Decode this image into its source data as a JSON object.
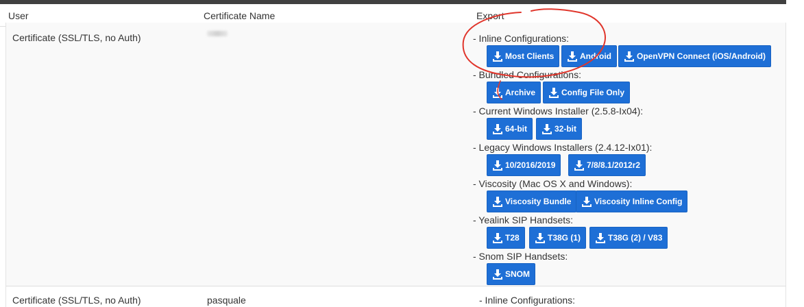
{
  "header": {
    "col_user": "User",
    "col_cert": "Certificate Name",
    "col_export": "Export"
  },
  "row1": {
    "user": "Certificate (SSL/TLS, no Auth)",
    "groups": [
      {
        "label": "- Inline Configurations:",
        "buttons": [
          "Most Clients",
          "Android",
          "OpenVPN Connect (iOS/Android)"
        ]
      },
      {
        "label": "- Bundled Configurations:",
        "buttons": [
          "Archive",
          "Config File Only"
        ]
      },
      {
        "label": "- Current Windows Installer (2.5.8-Ix04):",
        "buttons": [
          "64-bit",
          "32-bit"
        ]
      },
      {
        "label": "- Legacy Windows Installers (2.4.12-Ix01):",
        "buttons": [
          "10/2016/2019",
          "7/8/8.1/2012r2"
        ]
      },
      {
        "label": "- Viscosity (Mac OS X and Windows):",
        "buttons": [
          "Viscosity Bundle",
          "Viscosity Inline Config"
        ]
      },
      {
        "label": "- Yealink SIP Handsets:",
        "buttons": [
          "T28",
          "T38G (1)",
          "T38G (2) / V83"
        ]
      },
      {
        "label": "- Snom SIP Handsets:",
        "buttons": [
          "SNOM"
        ]
      }
    ]
  },
  "row2": {
    "user": "Certificate (SSL/TLS, no Auth)",
    "cert": "pasquale",
    "export_first": "- Inline Configurations:"
  },
  "colors": {
    "button": "#1e6fd6",
    "annotation": "#e0352b",
    "topbar": "#404040"
  },
  "icons": {
    "button_icon": "download-icon"
  }
}
